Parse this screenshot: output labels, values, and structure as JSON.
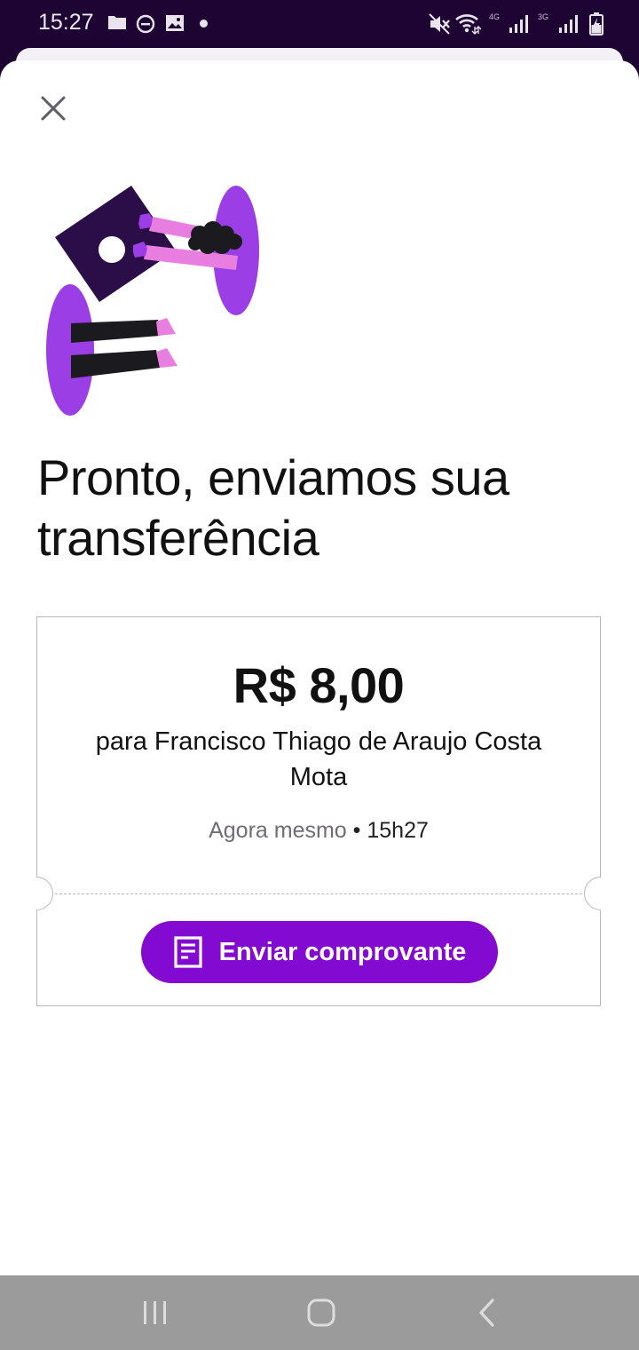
{
  "status_bar": {
    "time": "15:27",
    "network_a": "4G",
    "network_b": "3G"
  },
  "title": "Pronto, enviamos sua transferência",
  "receipt": {
    "amount": "R$ 8,00",
    "recipient": "para Francisco Thiago de Araujo Costa Mota",
    "when": "Agora mesmo",
    "separator": " • ",
    "time": "15h27"
  },
  "send_button": {
    "label": "Enviar comprovante",
    "icon": "receipt-icon"
  },
  "colors": {
    "brand": "#820ad1",
    "status_bar": "#1e0432",
    "illustration_purple": "#9b3ee6",
    "illustration_dark": "#2b0e47",
    "illustration_pink": "#e87fe0"
  }
}
